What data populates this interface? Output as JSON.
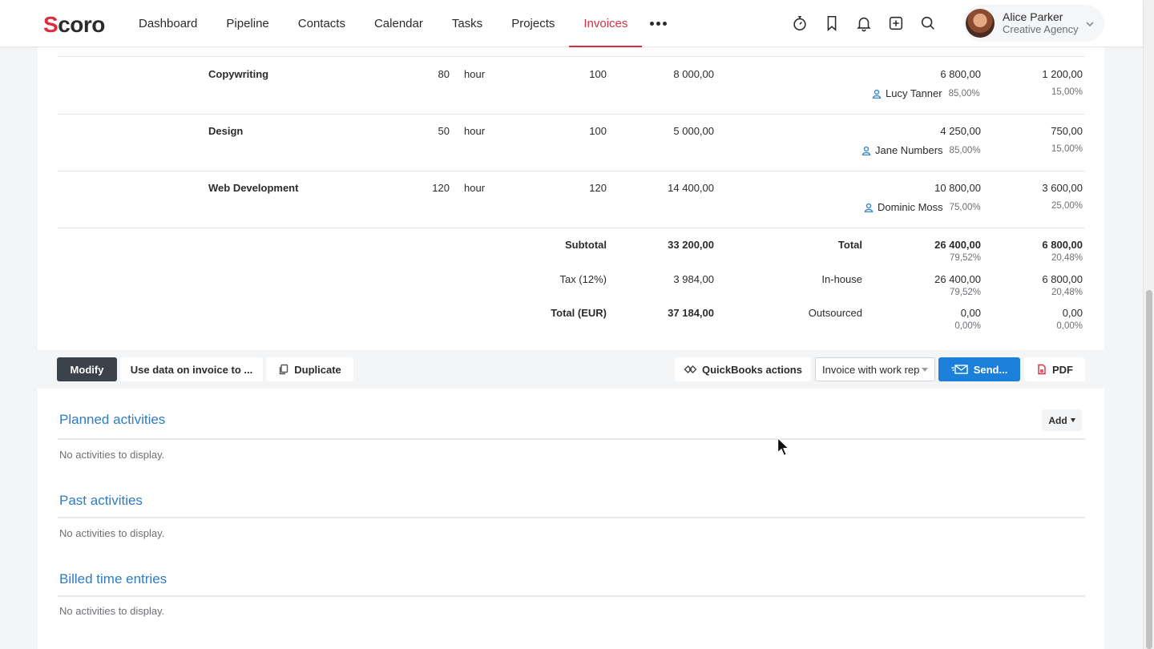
{
  "logo": "Scoro",
  "nav": {
    "items": [
      "Dashboard",
      "Pipeline",
      "Contacts",
      "Calendar",
      "Tasks",
      "Projects",
      "Invoices"
    ],
    "active": "Invoices",
    "more_icon": "more-horizontal-icon"
  },
  "toolbar_icons": [
    "timer-icon",
    "bookmark-icon",
    "bell-icon",
    "plus-square-icon",
    "search-icon"
  ],
  "user": {
    "name": "Alice Parker",
    "organization": "Creative Agency"
  },
  "invoice_lines": [
    {
      "product": "Copywriting",
      "qty": "80",
      "unit": "hour",
      "price": "100",
      "sum": "8 000,00",
      "inhouse_amount": "6 800,00",
      "person": "Lucy Tanner",
      "person_pct": "85,00%",
      "outsourced_amount": "1 200,00",
      "outsourced_pct": "15,00%"
    },
    {
      "product": "Design",
      "qty": "50",
      "unit": "hour",
      "price": "100",
      "sum": "5 000,00",
      "inhouse_amount": "4 250,00",
      "person": "Jane Numbers",
      "person_pct": "85,00%",
      "outsourced_amount": "750,00",
      "outsourced_pct": "15,00%"
    },
    {
      "product": "Web Development",
      "qty": "120",
      "unit": "hour",
      "price": "120",
      "sum": "14 400,00",
      "inhouse_amount": "10 800,00",
      "person": "Dominic Moss",
      "person_pct": "75,00%",
      "outsourced_amount": "3 600,00",
      "outsourced_pct": "25,00%"
    }
  ],
  "summary": {
    "subtotal_label": "Subtotal",
    "subtotal_value": "33 200,00",
    "tax_label": "Tax (12%)",
    "tax_value": "3 984,00",
    "total_label": "Total (EUR)",
    "total_value": "37 184,00"
  },
  "split": {
    "total": {
      "label": "Total",
      "a": "26 400,00",
      "a_pct": "79,52%",
      "b": "6 800,00",
      "b_pct": "20,48%"
    },
    "inhouse": {
      "label": "In-house",
      "a": "26 400,00",
      "a_pct": "79,52%",
      "b": "6 800,00",
      "b_pct": "20,48%"
    },
    "outsourced": {
      "label": "Outsourced",
      "a": "0,00",
      "a_pct": "0,00%",
      "b": "0,00",
      "b_pct": "0,00%"
    }
  },
  "actions": {
    "modify": "Modify",
    "use_data": "Use data on invoice to ...",
    "duplicate": "Duplicate",
    "quickbooks": "QuickBooks actions",
    "template_select": "Invoice with work rep",
    "send": "Send...",
    "pdf": "PDF"
  },
  "activities": {
    "planned_title": "Planned activities",
    "add_label": "Add",
    "past_title": "Past activities",
    "billed_title": "Billed time entries",
    "empty_text": "No activities to display."
  },
  "colors": {
    "accent_red": "#d72d43",
    "link_blue": "#2f7cc0",
    "send_blue": "#1c7fd9",
    "dark_button": "#3c4249"
  }
}
